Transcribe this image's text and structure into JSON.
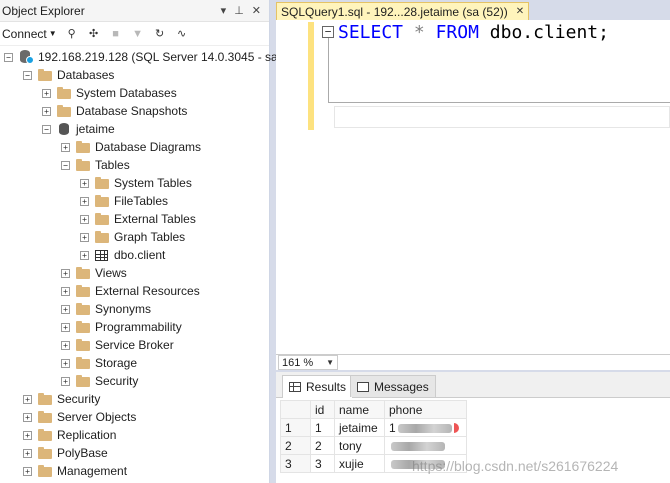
{
  "object_explorer": {
    "title": "Object Explorer",
    "title_buttons": [
      "▾",
      "⊥",
      "✕"
    ],
    "connect_label": "Connect",
    "tree": [
      {
        "label": "192.168.219.128 (SQL Server 14.0.3045 - sa)",
        "icon": "server-icon",
        "exp": "−",
        "level": 0
      },
      {
        "label": "Databases",
        "icon": "folder-icon",
        "exp": "−",
        "level": 1
      },
      {
        "label": "System Databases",
        "icon": "folder-icon",
        "exp": "+",
        "level": 2
      },
      {
        "label": "Database Snapshots",
        "icon": "folder-icon",
        "exp": "+",
        "level": 2
      },
      {
        "label": "jetaime",
        "icon": "database-icon",
        "exp": "−",
        "level": 2
      },
      {
        "label": "Database Diagrams",
        "icon": "folder-icon",
        "exp": "+",
        "level": 3
      },
      {
        "label": "Tables",
        "icon": "folder-icon",
        "exp": "−",
        "level": 3
      },
      {
        "label": "System Tables",
        "icon": "folder-icon",
        "exp": "+",
        "level": 4
      },
      {
        "label": "FileTables",
        "icon": "folder-icon",
        "exp": "+",
        "level": 4
      },
      {
        "label": "External Tables",
        "icon": "folder-icon",
        "exp": "+",
        "level": 4
      },
      {
        "label": "Graph Tables",
        "icon": "folder-icon",
        "exp": "+",
        "level": 4
      },
      {
        "label": "dbo.client",
        "icon": "table-icon",
        "exp": "+",
        "level": 4
      },
      {
        "label": "Views",
        "icon": "folder-icon",
        "exp": "+",
        "level": 3
      },
      {
        "label": "External Resources",
        "icon": "folder-icon",
        "exp": "+",
        "level": 3
      },
      {
        "label": "Synonyms",
        "icon": "folder-icon",
        "exp": "+",
        "level": 3
      },
      {
        "label": "Programmability",
        "icon": "folder-icon",
        "exp": "+",
        "level": 3
      },
      {
        "label": "Service Broker",
        "icon": "folder-icon",
        "exp": "+",
        "level": 3
      },
      {
        "label": "Storage",
        "icon": "folder-icon",
        "exp": "+",
        "level": 3
      },
      {
        "label": "Security",
        "icon": "folder-icon",
        "exp": "+",
        "level": 3
      },
      {
        "label": "Security",
        "icon": "folder-icon",
        "exp": "+",
        "level": 1
      },
      {
        "label": "Server Objects",
        "icon": "folder-icon",
        "exp": "+",
        "level": 1
      },
      {
        "label": "Replication",
        "icon": "folder-icon",
        "exp": "+",
        "level": 1
      },
      {
        "label": "PolyBase",
        "icon": "folder-icon",
        "exp": "+",
        "level": 1
      },
      {
        "label": "Management",
        "icon": "folder-icon",
        "exp": "+",
        "level": 1
      }
    ]
  },
  "editor": {
    "tab_title": "SQLQuery1.sql - 192...28.jetaime (sa (52))",
    "tab_close": "✕",
    "outline_toggle": "−",
    "sql": {
      "kw1": "SELECT",
      "op": "*",
      "kw2": "FROM",
      "ident": "dbo.client;"
    }
  },
  "zoom": {
    "value": "161 %"
  },
  "results": {
    "tabs": [
      {
        "label": "Results",
        "active": true
      },
      {
        "label": "Messages",
        "active": false
      }
    ],
    "columns": [
      "",
      "id",
      "name",
      "phone"
    ],
    "rows": [
      {
        "num": "1",
        "id": "1",
        "name": "jetaime",
        "phone_visible": "1"
      },
      {
        "num": "2",
        "id": "2",
        "name": "tony",
        "phone_visible": ""
      },
      {
        "num": "3",
        "id": "3",
        "name": "xujie",
        "phone_visible": ""
      }
    ]
  },
  "watermark": "https://blog.csdn.net/s261676224",
  "colors": {
    "tab_active": "#fff4bc",
    "keyword": "#0000ff",
    "editor_margin": "#fde27f"
  }
}
